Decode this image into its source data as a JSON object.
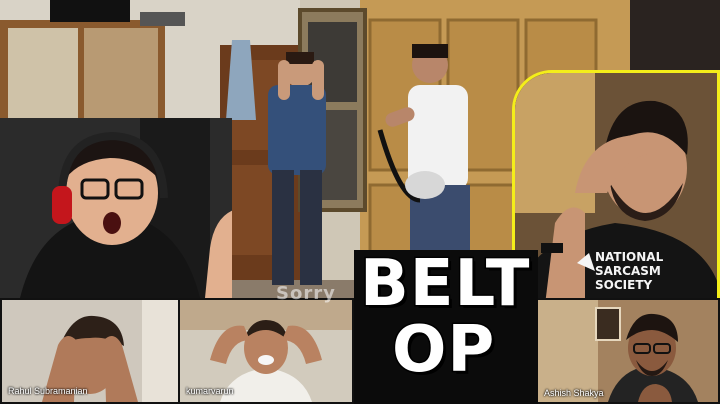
{
  "title": {
    "line1": "BELT",
    "line2": "OP"
  },
  "participants": [
    {
      "name": "Rahul Subramanian"
    },
    {
      "name": "kumarvarun"
    },
    {
      "name": "Ashish Shakya"
    }
  ],
  "shirt_text": {
    "line1": "NATIONAL",
    "line2": "SARCASM",
    "line3": "SOCIETY"
  },
  "watermark": "Sorry",
  "colors": {
    "frame_yellow": "#f4ee1a",
    "title_fill": "#ffffff",
    "title_stroke": "#000000"
  }
}
